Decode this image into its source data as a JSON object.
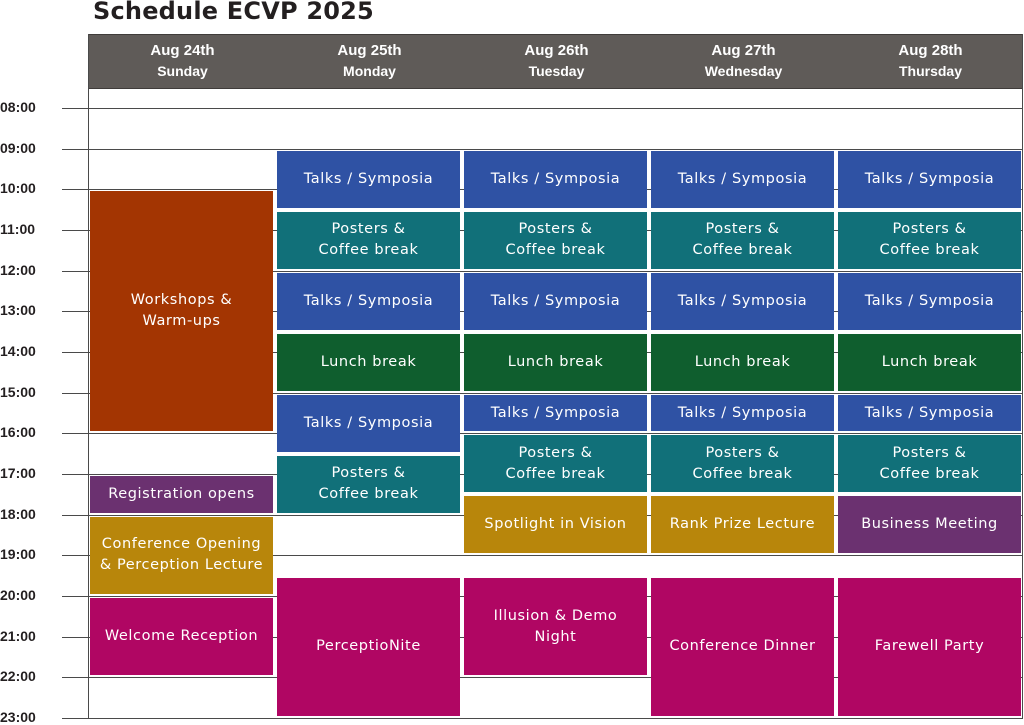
{
  "title": "Schedule ECVP 2025",
  "days": [
    {
      "date": "Aug 24th",
      "weekday": "Sunday"
    },
    {
      "date": "Aug 25th",
      "weekday": "Monday"
    },
    {
      "date": "Aug 26th",
      "weekday": "Tuesday"
    },
    {
      "date": "Aug 27th",
      "weekday": "Wednesday"
    },
    {
      "date": "Aug 28th",
      "weekday": "Thursday"
    }
  ],
  "times": [
    "08:00",
    "09:00",
    "10:00",
    "11:00",
    "12:00",
    "13:00",
    "14:00",
    "15:00",
    "16:00",
    "17:00",
    "18:00",
    "19:00",
    "20:00",
    "21:00",
    "22:00",
    "23:00"
  ],
  "colors": {
    "header_bg": "#5f5b58",
    "talks": "#2f52a4",
    "posters": "#117079",
    "lunch": "#0f5e2e",
    "workshops": "#a33502",
    "registration": "#6b3170",
    "gold": "#b8860b",
    "business": "#6b3170",
    "social": "#b00663"
  },
  "events": [
    {
      "day": 0,
      "start": "10:00",
      "end": "16:00",
      "label": "Workshops &\nWarm-ups",
      "kind": "workshop"
    },
    {
      "day": 0,
      "start": "17:00",
      "end": "18:00",
      "label": "Registration opens",
      "kind": "reg"
    },
    {
      "day": 0,
      "start": "18:00",
      "end": "20:00",
      "label": "Conference Opening\n& Perception Lecture",
      "kind": "gold"
    },
    {
      "day": 0,
      "start": "20:00",
      "end": "22:00",
      "label": "Welcome Reception",
      "kind": "magenta"
    },
    {
      "day": 1,
      "start": "09:00",
      "end": "10:30",
      "label": "Talks / Symposia",
      "kind": "talk"
    },
    {
      "day": 1,
      "start": "10:30",
      "end": "12:00",
      "label": "Posters &\nCoffee break",
      "kind": "post"
    },
    {
      "day": 1,
      "start": "12:00",
      "end": "13:30",
      "label": "Talks / Symposia",
      "kind": "talk"
    },
    {
      "day": 1,
      "start": "13:30",
      "end": "15:00",
      "label": "Lunch break",
      "kind": "lunch"
    },
    {
      "day": 1,
      "start": "15:00",
      "end": "16:30",
      "label": "Talks / Symposia",
      "kind": "talk"
    },
    {
      "day": 1,
      "start": "16:30",
      "end": "18:00",
      "label": "Posters &\nCoffee break",
      "kind": "post"
    },
    {
      "day": 1,
      "start": "19:30",
      "end": "23:00",
      "label": "PerceptioNite",
      "kind": "magenta"
    },
    {
      "day": 2,
      "start": "09:00",
      "end": "10:30",
      "label": "Talks / Symposia",
      "kind": "talk"
    },
    {
      "day": 2,
      "start": "10:30",
      "end": "12:00",
      "label": "Posters &\nCoffee break",
      "kind": "post"
    },
    {
      "day": 2,
      "start": "12:00",
      "end": "13:30",
      "label": "Talks / Symposia",
      "kind": "talk"
    },
    {
      "day": 2,
      "start": "13:30",
      "end": "15:00",
      "label": "Lunch break",
      "kind": "lunch"
    },
    {
      "day": 2,
      "start": "15:00",
      "end": "16:00",
      "label": "Talks / Symposia",
      "kind": "talk"
    },
    {
      "day": 2,
      "start": "16:00",
      "end": "17:30",
      "label": "Posters &\nCoffee break",
      "kind": "post"
    },
    {
      "day": 2,
      "start": "17:30",
      "end": "19:00",
      "label": "Spotlight in Vision",
      "kind": "gold"
    },
    {
      "day": 2,
      "start": "19:30",
      "end": "22:00",
      "label": "Illusion & Demo\nNight",
      "kind": "magenta"
    },
    {
      "day": 3,
      "start": "09:00",
      "end": "10:30",
      "label": "Talks / Symposia",
      "kind": "talk"
    },
    {
      "day": 3,
      "start": "10:30",
      "end": "12:00",
      "label": "Posters &\nCoffee break",
      "kind": "post"
    },
    {
      "day": 3,
      "start": "12:00",
      "end": "13:30",
      "label": "Talks / Symposia",
      "kind": "talk"
    },
    {
      "day": 3,
      "start": "13:30",
      "end": "15:00",
      "label": "Lunch break",
      "kind": "lunch"
    },
    {
      "day": 3,
      "start": "15:00",
      "end": "16:00",
      "label": "Talks / Symposia",
      "kind": "talk"
    },
    {
      "day": 3,
      "start": "16:00",
      "end": "17:30",
      "label": "Posters &\nCoffee break",
      "kind": "post"
    },
    {
      "day": 3,
      "start": "17:30",
      "end": "19:00",
      "label": "Rank Prize Lecture",
      "kind": "gold"
    },
    {
      "day": 3,
      "start": "19:30",
      "end": "23:00",
      "label": "Conference Dinner",
      "kind": "magenta"
    },
    {
      "day": 4,
      "start": "09:00",
      "end": "10:30",
      "label": "Talks / Symposia",
      "kind": "talk"
    },
    {
      "day": 4,
      "start": "10:30",
      "end": "12:00",
      "label": "Posters &\nCoffee break",
      "kind": "post"
    },
    {
      "day": 4,
      "start": "12:00",
      "end": "13:30",
      "label": "Talks / Symposia",
      "kind": "talk"
    },
    {
      "day": 4,
      "start": "13:30",
      "end": "15:00",
      "label": "Lunch break",
      "kind": "lunch"
    },
    {
      "day": 4,
      "start": "15:00",
      "end": "16:00",
      "label": "Talks / Symposia",
      "kind": "talk"
    },
    {
      "day": 4,
      "start": "16:00",
      "end": "17:30",
      "label": "Posters &\nCoffee break",
      "kind": "post"
    },
    {
      "day": 4,
      "start": "17:30",
      "end": "19:00",
      "label": "Business Meeting",
      "kind": "purple"
    },
    {
      "day": 4,
      "start": "19:30",
      "end": "23:00",
      "label": "Farewell Party",
      "kind": "magenta"
    }
  ]
}
